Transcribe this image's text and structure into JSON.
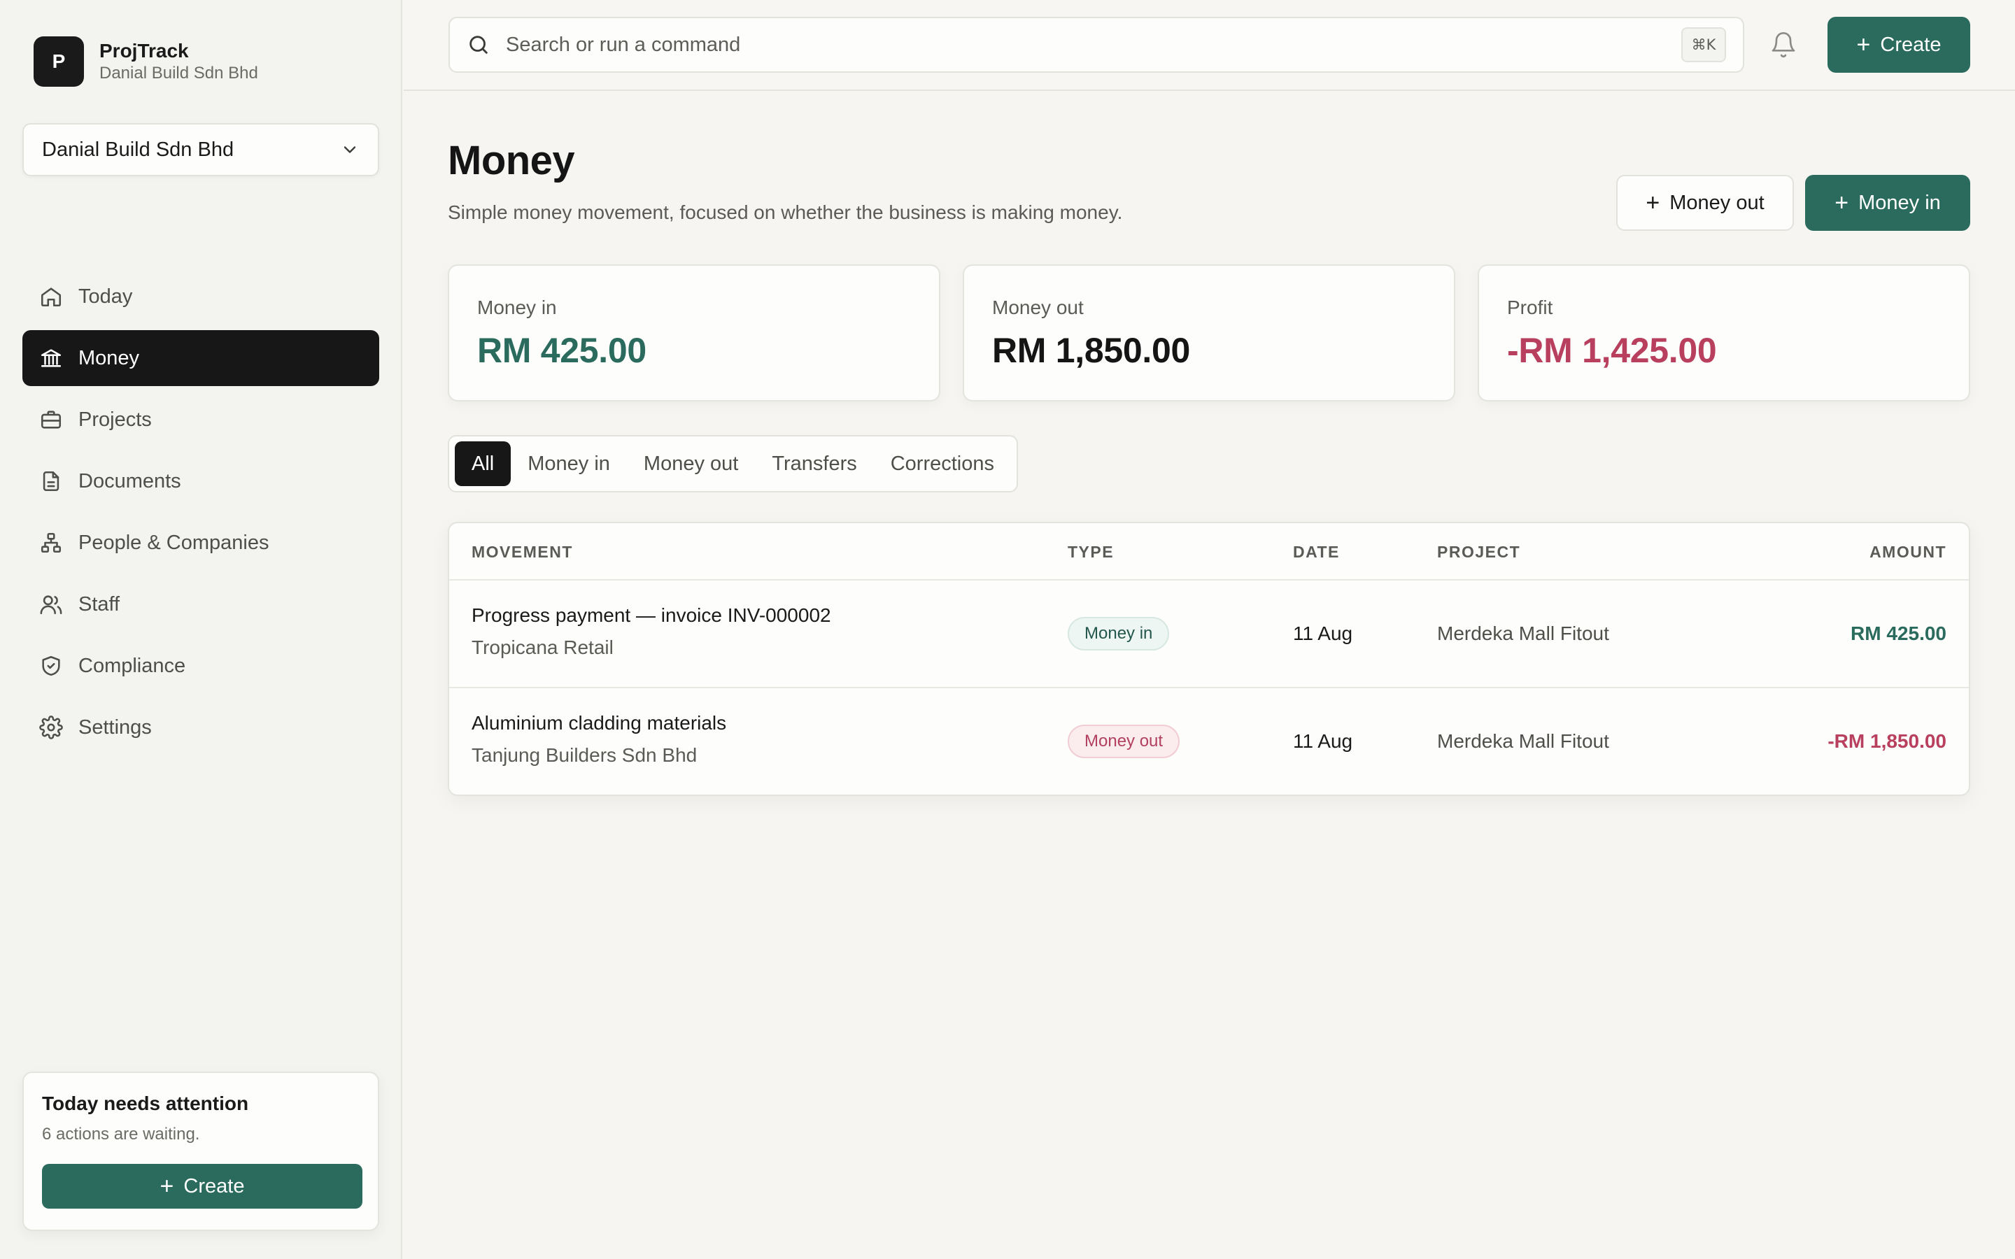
{
  "brand": {
    "logo_letter": "P",
    "name": "ProjTrack",
    "company": "Danial Build Sdn Bhd"
  },
  "org_select": {
    "value": "Danial Build Sdn Bhd",
    "icon": "chevron-down-icon"
  },
  "nav": [
    {
      "label": "Today",
      "icon": "home-icon",
      "active": false
    },
    {
      "label": "Money",
      "icon": "bank-icon",
      "active": true
    },
    {
      "label": "Projects",
      "icon": "briefcase-icon",
      "active": false
    },
    {
      "label": "Documents",
      "icon": "document-icon",
      "active": false
    },
    {
      "label": "People & Companies",
      "icon": "org-chart-icon",
      "active": false
    },
    {
      "label": "Staff",
      "icon": "users-icon",
      "active": false
    },
    {
      "label": "Compliance",
      "icon": "shield-icon",
      "active": false
    },
    {
      "label": "Settings",
      "icon": "gear-icon",
      "active": false
    }
  ],
  "attention": {
    "title": "Today needs attention",
    "subtitle": "6 actions are waiting.",
    "button": "Create"
  },
  "topbar": {
    "search_placeholder": "Search or run a command",
    "shortcut": "⌘K",
    "create_label": "Create"
  },
  "page": {
    "title": "Money",
    "subtitle": "Simple money movement, focused on whether the business is making money.",
    "money_out_button": "Money out",
    "money_in_button": "Money in"
  },
  "stats": [
    {
      "label": "Money in",
      "value": "RM 425.00",
      "color": "#2a6b5d"
    },
    {
      "label": "Money out",
      "value": "RM 1,850.00",
      "color": "#151515"
    },
    {
      "label": "Profit",
      "value": "-RM 1,425.00",
      "color": "#b8405e"
    }
  ],
  "tabs": [
    {
      "label": "All",
      "active": true
    },
    {
      "label": "Money in",
      "active": false
    },
    {
      "label": "Money out",
      "active": false
    },
    {
      "label": "Transfers",
      "active": false
    },
    {
      "label": "Corrections",
      "active": false
    }
  ],
  "table": {
    "headers": {
      "movement": "MOVEMENT",
      "type": "TYPE",
      "date": "DATE",
      "project": "PROJECT",
      "amount": "AMOUNT"
    },
    "rows": [
      {
        "title": "Progress payment — invoice INV-000002",
        "party": "Tropicana Retail",
        "type": "Money in",
        "type_kind": "in",
        "date": "11 Aug",
        "project": "Merdeka Mall Fitout",
        "amount": "RM 425.00",
        "amount_color": "#2a6b5d"
      },
      {
        "title": "Aluminium cladding materials",
        "party": "Tanjung Builders Sdn Bhd",
        "type": "Money out",
        "type_kind": "out",
        "date": "11 Aug",
        "project": "Merdeka Mall Fitout",
        "amount": "-RM 1,850.00",
        "amount_color": "#b8405e"
      }
    ]
  },
  "colors": {
    "accent": "#2a6b5d",
    "negative": "#b8405e",
    "dark": "#171717"
  }
}
